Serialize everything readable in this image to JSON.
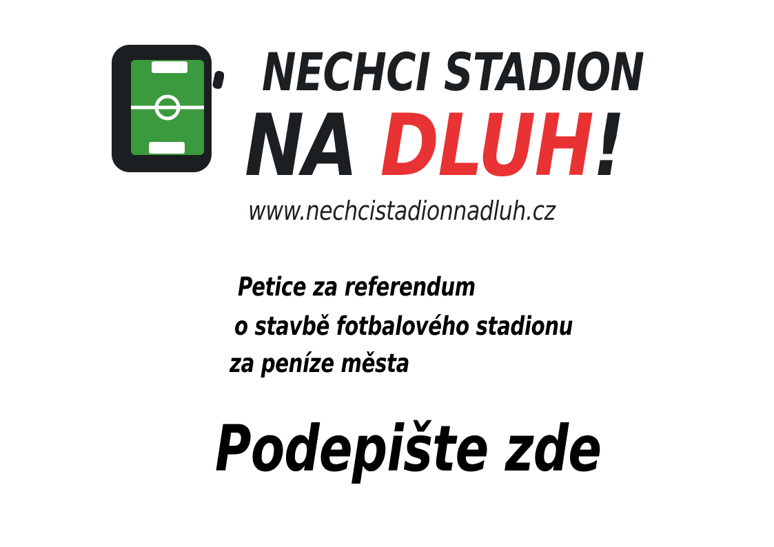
{
  "logo": {
    "icon": "football-pitch-phone-icon",
    "line1": "NECHCI STADION",
    "line2_part1": "NA ",
    "line2_part2": "DLUH",
    "line2_part3": "!",
    "url": "www.nechcistadionnadluh.cz"
  },
  "petition": {
    "line1": "Petice za referendum",
    "line2": "o stavbě fotbalového stadionu",
    "line3": "za peníze města"
  },
  "call_to_action": "Podepište zde",
  "colors": {
    "dark": "#1c1f22",
    "accent_red": "#e83233",
    "pitch_green": "#3b9a3e",
    "text": "#000000",
    "background": "#ffffff"
  }
}
